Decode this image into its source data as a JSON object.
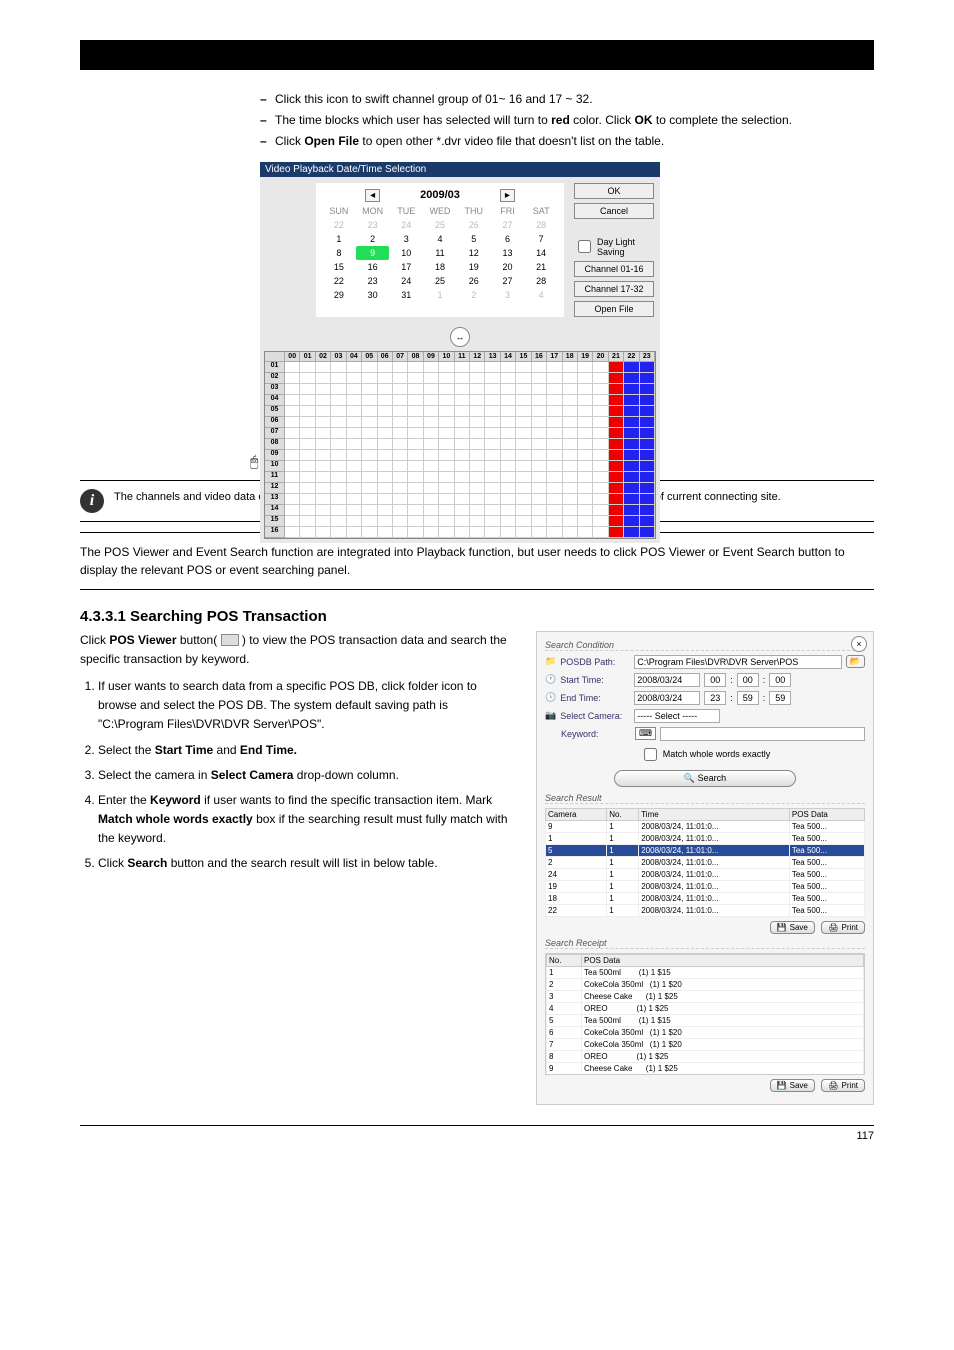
{
  "topbar": {
    "spacer": ""
  },
  "bullets": {
    "b1": "Click this icon to swift channel group of 01~ 16 and 17 ~ 32.",
    "b2_a": "The time blocks which user has selected will turn to",
    "b2_b": "red",
    "b2_c": "Click",
    "b2_d": "OK",
    "b2_e": "to complete the selection.",
    "b3_a": "Click",
    "b3_b": "Open File",
    "b3_c": "to open other *.dvr video file that doesn't list on the table.",
    "color_word": " color. "
  },
  "calendar": {
    "window_title": "Video Playback Date/Time Selection",
    "month": "2009/03",
    "dow": [
      "SUN",
      "MON",
      "TUE",
      "WED",
      "THU",
      "FRI",
      "SAT"
    ],
    "rows": [
      [
        "22",
        "23",
        "24",
        "25",
        "26",
        "27",
        "28"
      ],
      [
        "1",
        "2",
        "3",
        "4",
        "5",
        "6",
        "7"
      ],
      [
        "8",
        "9",
        "10",
        "11",
        "12",
        "13",
        "14"
      ],
      [
        "15",
        "16",
        "17",
        "18",
        "19",
        "20",
        "21"
      ],
      [
        "22",
        "23",
        "24",
        "25",
        "26",
        "27",
        "28"
      ],
      [
        "29",
        "30",
        "31",
        "1",
        "2",
        "3",
        "4"
      ]
    ],
    "buttons": {
      "ok": "OK",
      "cancel": "Cancel",
      "daylight": "Day Light Saving",
      "ch1": "Channel 01-16",
      "ch2": "Channel 17-32",
      "openfile": "Open File"
    },
    "hours": [
      "00",
      "01",
      "02",
      "03",
      "04",
      "05",
      "06",
      "07",
      "08",
      "09",
      "10",
      "11",
      "12",
      "13",
      "14",
      "15",
      "16",
      "17",
      "18",
      "19",
      "20",
      "21",
      "22",
      "23"
    ],
    "channels": [
      "01",
      "02",
      "03",
      "04",
      "05",
      "06",
      "07",
      "08",
      "09",
      "10",
      "11",
      "12",
      "13",
      "14",
      "15",
      "16"
    ]
  },
  "info": {
    "text_a": "The channels and video data on the ",
    "text_b": "Video Playback Date/Time Selection",
    "text_c": " only display the channels and data of current connecting site."
  },
  "hr_note": "The POS Viewer and Event Search function are integrated into Playback function, but user needs to click POS Viewer or Event Search button to display the relevant POS or event searching panel.",
  "section_title": "4.3.3.1 Searching POS Transaction",
  "pos_intro_1": "Click ",
  "pos_intro_2": "POS Viewer",
  "pos_intro_3": " button(",
  "pos_intro_4": ") to view the POS transaction data and search the specific transaction by keyword.",
  "steps": {
    "s1": "If user wants to search data from a specific POS DB, click folder icon to browse and select the POS DB. The system default saving path is \"C:\\Program Files\\DVR\\DVR Server\\POS\".",
    "s2_a": "Select the ",
    "s2_b": "Start Time",
    "s2_c": " and ",
    "s2_d": "End Time.",
    "s3_a": "Select the camera in ",
    "s3_b": "Select Camera",
    "s3_c": " drop-down column.",
    "s4_a": "Enter the ",
    "s4_b": "Keyword",
    "s4_c": " if user wants to find the specific transaction item. Mark ",
    "s4_d": "Match whole words exactly",
    "s4_e": " box if the searching result must fully match with the keyword.",
    "s5_a": "Click ",
    "s5_b": "Search",
    "s5_c": " button and the search result will list in below table."
  },
  "pospanel": {
    "group1": "Search Condition",
    "posdb_label": "POSDB Path:",
    "posdb_value": "C:\\Program Files\\DVR\\DVR Server\\POS",
    "start_label": "Start Time:",
    "start_date": "2008/03/24",
    "end_label": "End Time:",
    "end_date": "2008/03/24",
    "h00": "00",
    "m00": "00",
    "s00": "00",
    "h23": "23",
    "m59": "59",
    "s59": "59",
    "selcam_label": "Select Camera:",
    "selcam_value": "----- Select -----",
    "keyword_label": "Keyword:",
    "match_label": "Match whole words exactly",
    "search_btn": "Search",
    "group2": "Search Result",
    "cols": {
      "camera": "Camera",
      "no": "No.",
      "time": "Time",
      "posdata": "POS Data"
    },
    "rows": [
      {
        "cam": "9",
        "no": "1",
        "time": "2008/03/24, 11:01:0...",
        "pos": "Tea 500..."
      },
      {
        "cam": "1",
        "no": "1",
        "time": "2008/03/24, 11:01:0...",
        "pos": "Tea 500..."
      },
      {
        "cam": "5",
        "no": "1",
        "time": "2008/03/24, 11:01:0...",
        "pos": "Tea 500...",
        "sel": true
      },
      {
        "cam": "2",
        "no": "1",
        "time": "2008/03/24, 11:01:0...",
        "pos": "Tea 500..."
      },
      {
        "cam": "24",
        "no": "1",
        "time": "2008/03/24, 11:01:0...",
        "pos": "Tea 500..."
      },
      {
        "cam": "19",
        "no": "1",
        "time": "2008/03/24, 11:01:0...",
        "pos": "Tea 500..."
      },
      {
        "cam": "18",
        "no": "1",
        "time": "2008/03/24, 11:01:0...",
        "pos": "Tea 500..."
      },
      {
        "cam": "22",
        "no": "1",
        "time": "2008/03/24, 11:01:0...",
        "pos": "Tea 500..."
      }
    ],
    "save_btn": "Save",
    "print_btn": "Print",
    "group3": "Search Receipt",
    "rcols": {
      "no": "No.",
      "posdata": "POS Data"
    },
    "rrows": [
      {
        "no": "1",
        "data": "Tea 500ml        (1) 1 $15"
      },
      {
        "no": "2",
        "data": "CokeCola 350ml   (1) 1 $20"
      },
      {
        "no": "3",
        "data": "Cheese Cake      (1) 1 $25"
      },
      {
        "no": "4",
        "data": "OREO             (1) 1 $25"
      },
      {
        "no": "5",
        "data": "Tea 500ml        (1) 1 $15"
      },
      {
        "no": "6",
        "data": "CokeCola 350ml   (1) 1 $20"
      },
      {
        "no": "7",
        "data": "CokeCola 350ml   (1) 1 $20"
      },
      {
        "no": "8",
        "data": "OREO             (1) 1 $25"
      },
      {
        "no": "9",
        "data": "Cheese Cake      (1) 1 $25"
      }
    ]
  },
  "footer": {
    "page": "117"
  }
}
